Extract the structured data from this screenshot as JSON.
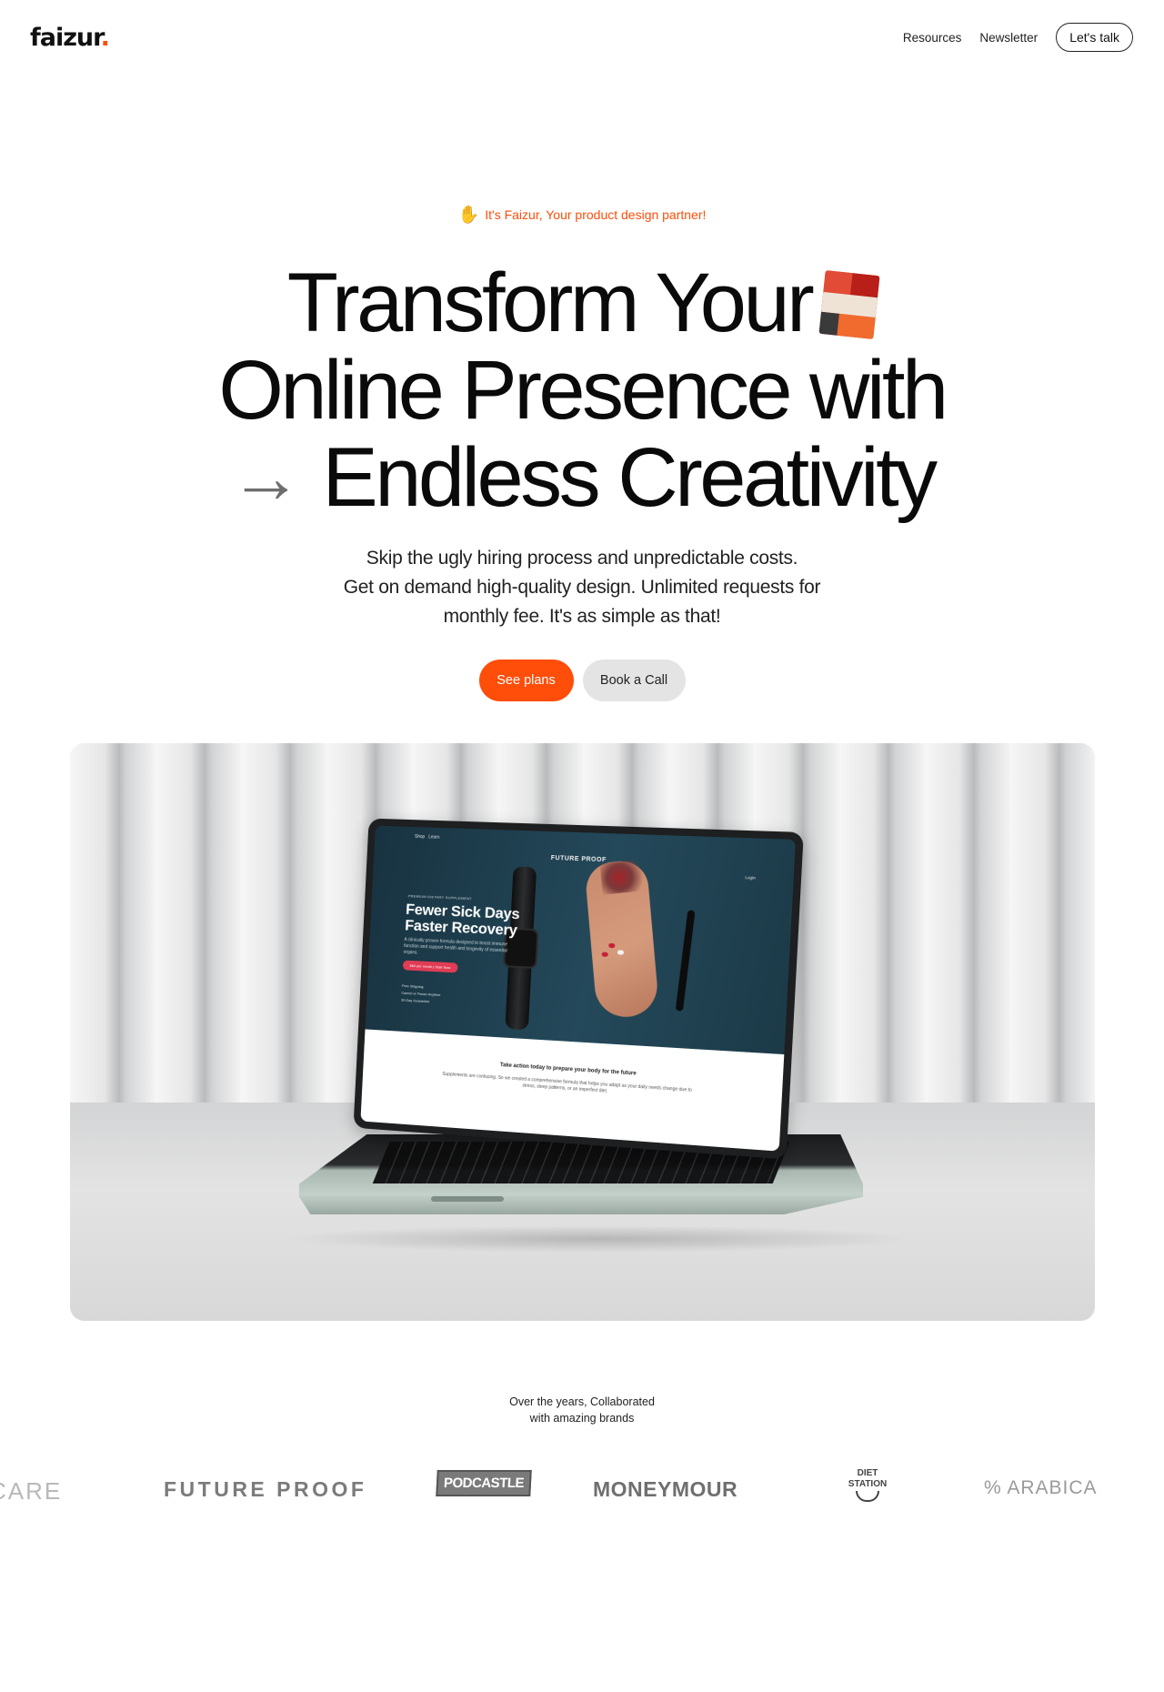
{
  "nav": {
    "logo_text": "faizur",
    "logo_dot": ".",
    "links": [
      "Resources",
      "Newsletter"
    ],
    "cta_label": "Let's talk"
  },
  "hero": {
    "eyebrow_icon": "waving-hand-icon",
    "eyebrow_text": "It's Faizur, Your product design partner!",
    "headline": {
      "line1": "Transform Your",
      "line2": "Online Presence with",
      "line3": "Endless Creativity"
    },
    "subtext": {
      "line1": "Skip the ugly hiring process and unpredictable costs.",
      "line2": "Get on demand high-quality design. Unlimited requests for",
      "line3": "monthly fee. It's as simple as that!"
    },
    "primary_cta": "See plans",
    "secondary_cta": "Book a Call"
  },
  "showcase": {
    "screen": {
      "nav_items": [
        "Shop",
        "Learn"
      ],
      "brand": "FUTURE PROOF",
      "login": "Login",
      "eyebrow": "PREMIUM DIETARY SUPPLEMENT",
      "title_line1": "Fewer Sick Days",
      "title_line2": "Faster Recovery",
      "description": "A clinically proven formula designed to boost immune function and support health and longevity of essential organs.",
      "button": "$60 per month | Start Now",
      "checks": [
        "Free Shipping",
        "Cancel or Pause Anytime",
        "30-Day Guarantee"
      ],
      "lower_title": "Take action today to prepare your body for the future",
      "lower_text": "Supplements are confusing. So we created a comprehensive formula that helps you adapt as your daily needs change due to stress, sleep patterns, or an imperfect diet."
    }
  },
  "brands": {
    "intro_line1": "Over the years, Collaborated",
    "intro_line2": "with amazing brands",
    "items": [
      "CARE",
      "FUTURE PROOF",
      "PODCASTLE",
      "MONEYMOUR",
      "DIET",
      "STATION",
      "% ARABICA"
    ]
  },
  "colors": {
    "accent": "#ff4d0a",
    "text": "#0a0a0a",
    "secondary_button": "#e4e4e4"
  }
}
